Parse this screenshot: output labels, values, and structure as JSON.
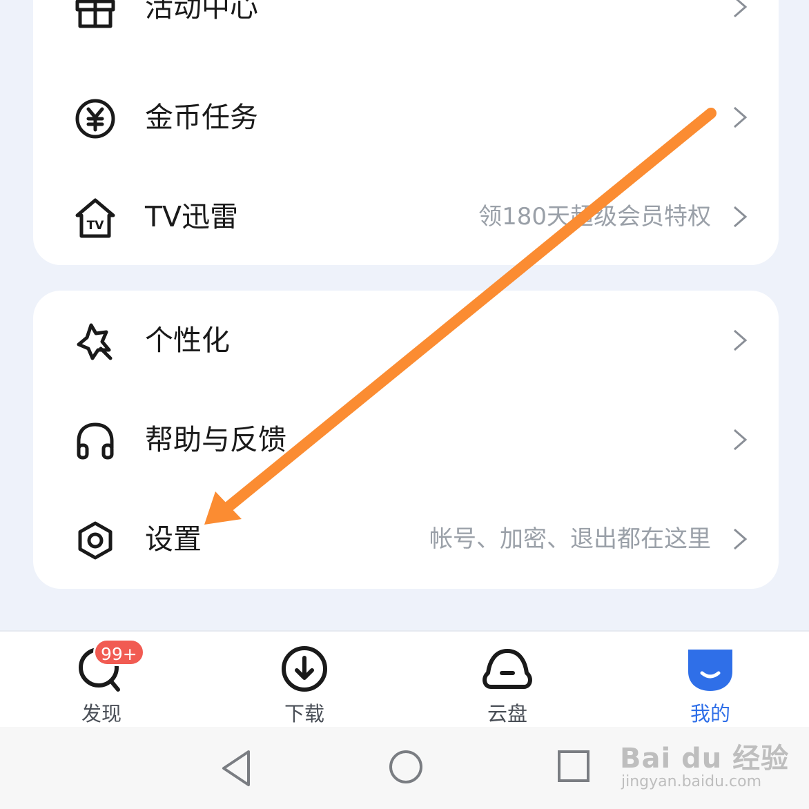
{
  "card1": {
    "items": [
      {
        "label": "活动中心",
        "sub": "",
        "icon": "gift-icon"
      },
      {
        "label": "金币任务",
        "sub": "",
        "icon": "yen-coin-icon"
      },
      {
        "label": "TV迅雷",
        "sub": "领180天超级会员特权",
        "icon": "tv-house-icon"
      }
    ]
  },
  "card2": {
    "items": [
      {
        "label": "个性化",
        "sub": "",
        "icon": "personalize-icon"
      },
      {
        "label": "帮助与反馈",
        "sub": "",
        "icon": "headphones-icon"
      },
      {
        "label": "设置",
        "sub": "帐号、加密、退出都在这里",
        "icon": "settings-hexagon-icon"
      }
    ]
  },
  "tabbar": {
    "tabs": [
      {
        "label": "发现",
        "icon": "discover-icon",
        "badge": "99+",
        "active": false
      },
      {
        "label": "下载",
        "icon": "download-icon",
        "active": false
      },
      {
        "label": "云盘",
        "icon": "cloud-drive-icon",
        "active": false
      },
      {
        "label": "我的",
        "icon": "mine-icon",
        "active": true
      }
    ]
  },
  "system_nav": [
    "back-icon",
    "home-icon",
    "recents-icon"
  ],
  "watermark": {
    "brand": "Bai du 经验",
    "url": "jingyan.baidu.com"
  },
  "colors": {
    "background": "#eef2fa",
    "card": "#ffffff",
    "accent": "#2f6fe8",
    "badge": "#f15b52",
    "annotation_arrow": "#fb8c32",
    "subtext": "#9aa0a8"
  }
}
